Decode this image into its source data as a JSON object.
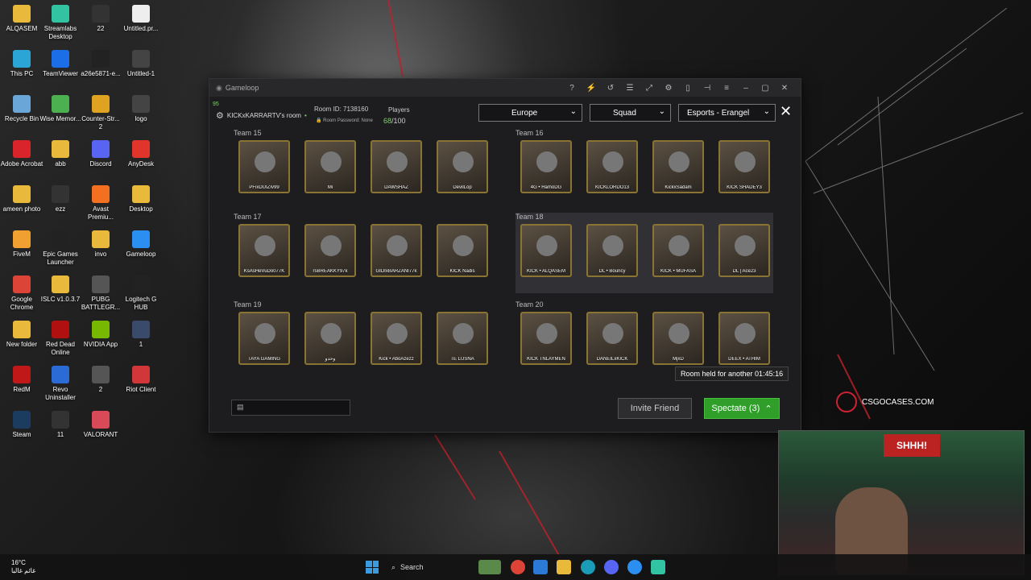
{
  "desktop_icons": [
    {
      "label": "ALQASEM",
      "icon": "folder-icon",
      "color": "#e8b93a"
    },
    {
      "label": "Streamlabs Desktop",
      "icon": "streamlabs-icon",
      "color": "#31c3a2"
    },
    {
      "label": "22",
      "icon": "image-file-icon",
      "color": "#333"
    },
    {
      "label": "Untitled.pr...",
      "icon": "document-icon",
      "color": "#eee"
    },
    {
      "label": "This PC",
      "icon": "monitor-icon",
      "color": "#2aa5d6"
    },
    {
      "label": "TeamViewer",
      "icon": "teamviewer-icon",
      "color": "#1c6ee8"
    },
    {
      "label": "a26e5871-e...",
      "icon": "image-file-icon",
      "color": "#222"
    },
    {
      "label": "Untitled-1",
      "icon": "logo-file-icon",
      "color": "#444"
    },
    {
      "label": "Recycle Bin",
      "icon": "recycle-bin-icon",
      "color": "#6aa7d8"
    },
    {
      "label": "Wise Memor...",
      "icon": "wise-memory-icon",
      "color": "#4caf50"
    },
    {
      "label": "Counter-Str... 2",
      "icon": "cs2-icon",
      "color": "#e0a321"
    },
    {
      "label": "logo",
      "icon": "logo-file-icon",
      "color": "#444"
    },
    {
      "label": "Adobe Acrobat",
      "icon": "acrobat-icon",
      "color": "#d9242b"
    },
    {
      "label": "abb",
      "icon": "folder-icon",
      "color": "#e8b93a"
    },
    {
      "label": "Discord",
      "icon": "discord-icon",
      "color": "#5865f2"
    },
    {
      "label": "AnyDesk",
      "icon": "anydesk-icon",
      "color": "#e1352c"
    },
    {
      "label": "ameen photo",
      "icon": "folder-icon",
      "color": "#e8b93a"
    },
    {
      "label": "ezz",
      "icon": "image-file-icon",
      "color": "#333"
    },
    {
      "label": "Avast Premiu...",
      "icon": "avast-icon",
      "color": "#f37021"
    },
    {
      "label": "Desktop",
      "icon": "folder-icon",
      "color": "#e8b93a"
    },
    {
      "label": "FiveM",
      "icon": "fivem-icon",
      "color": "#f0a030"
    },
    {
      "label": "Epic Games Launcher",
      "icon": "epic-games-icon",
      "color": "#222"
    },
    {
      "label": "invo",
      "icon": "folder-icon",
      "color": "#e8b93a"
    },
    {
      "label": "Gameloop",
      "icon": "gameloop-icon",
      "color": "#2a8ff0"
    },
    {
      "label": "Google Chrome",
      "icon": "chrome-icon",
      "color": "#db4437"
    },
    {
      "label": "ISLC v1.0.3.7",
      "icon": "folder-icon",
      "color": "#e8b93a"
    },
    {
      "label": "PUBG BATTLEGR...",
      "icon": "pubg-icon",
      "color": "#555"
    },
    {
      "label": "Logitech G HUB",
      "icon": "logitech-icon",
      "color": "#222"
    },
    {
      "label": "New folder",
      "icon": "folder-icon",
      "color": "#e8b93a"
    },
    {
      "label": "Red Dead Online",
      "icon": "rdo-icon",
      "color": "#b01010"
    },
    {
      "label": "NVIDIA App",
      "icon": "nvidia-icon",
      "color": "#76b900"
    },
    {
      "label": "1",
      "icon": "image-file-icon",
      "color": "#3a4a6a"
    },
    {
      "label": "RedM",
      "icon": "redm-icon",
      "color": "#c01818"
    },
    {
      "label": "Revo Uninstaller",
      "icon": "revo-icon",
      "color": "#2a6bd6"
    },
    {
      "label": "2",
      "icon": "image-file-icon",
      "color": "#555"
    },
    {
      "label": "Riot Client",
      "icon": "riot-icon",
      "color": "#d13639"
    },
    {
      "label": "Steam",
      "icon": "steam-icon",
      "color": "#1b3b5f"
    },
    {
      "label": "11",
      "icon": "image-file-icon",
      "color": "#333"
    },
    {
      "label": "VALORANT",
      "icon": "valorant-icon",
      "color": "#d84a57"
    }
  ],
  "window": {
    "title": "Gameloop",
    "controls": [
      "?",
      "⚡",
      "↺",
      "☰",
      "⤢",
      "⚙",
      "▯",
      "⊣",
      "≡",
      "–",
      "▢",
      "✕"
    ]
  },
  "room": {
    "level": "95",
    "name": "KICKxKARRARTV's room",
    "room_id": "Room ID: 7138160",
    "password": "Room Password: None",
    "players_label": "Players",
    "players_count": "68",
    "players_total": "/100"
  },
  "filters": {
    "region": "Europe",
    "mode": "Squad",
    "map": "Esports - Erangel"
  },
  "teams": [
    {
      "label": "Team 15",
      "players": [
        "PFixDUIZIv99",
        "Mi",
        "DAWSHAZ",
        "DevilLop"
      ]
    },
    {
      "label": "Team 16",
      "players": [
        "4G • HamoDG",
        "KICKLORDO13",
        "KickxSadam",
        "KICK SHADEY3"
      ]
    },
    {
      "label": "Team 17",
      "players": [
        "KsAsHeVuDo077K",
        "rsBREAKKY97k",
        "GIDIxBARZANI77k",
        "KICK Nadis"
      ]
    },
    {
      "label": "Team 18",
      "players": [
        "KICK • ALQASEM",
        "DL • Bouncy",
        "KICK • MUFASA",
        "DL | Ace23"
      ]
    },
    {
      "label": "Team 19",
      "players": [
        "TAYA GAMING",
        "وحدو",
        "Kick • AboAzezz",
        "TE LUSNA"
      ]
    },
    {
      "label": "Team 20",
      "players": [
        "KICK TNLAYMEN",
        "DANEILxKICK",
        "MjxD",
        "DEEX • ATHIM"
      ]
    }
  ],
  "tooltip": "Room held for another 01:45:16",
  "actions": {
    "invite": "Invite Friend",
    "spectate": "Spectate (3)"
  },
  "overlay": {
    "csgocases": "CSGOCASES.COM",
    "webcam_sign": "SHHH!"
  },
  "taskbar": {
    "weather_temp": "16°C",
    "weather_desc": "غائم غالبا",
    "search": "Search"
  },
  "colors": {
    "accent_green": "#2f9f2a",
    "gold_frame": "#8a7433",
    "window_bg": "#1d1d1f"
  }
}
